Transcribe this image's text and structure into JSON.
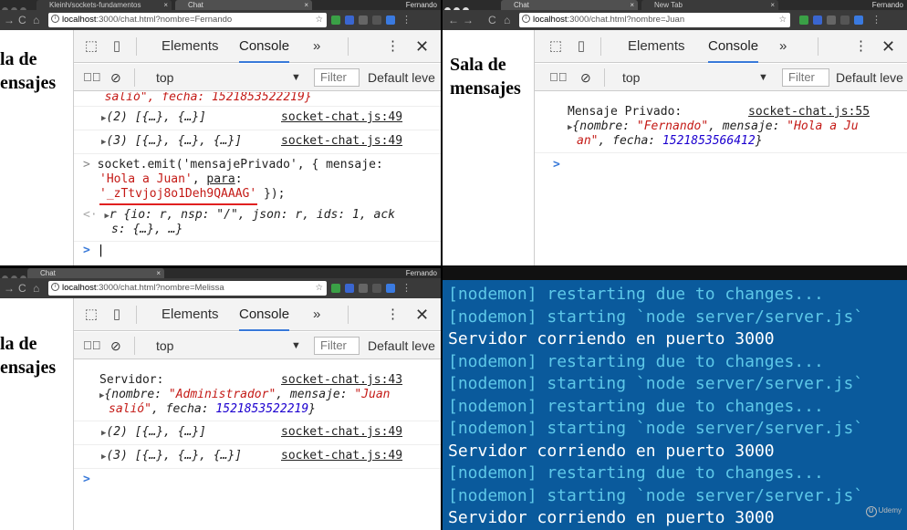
{
  "windows": [
    {
      "tabs": [
        {
          "label": "Kleinh/sockets-fundamentos"
        },
        {
          "label": "Chat"
        }
      ],
      "profile": "Fernando",
      "url_host": "localhost",
      "url_path": ":3000/chat.html?nombre=Fernando",
      "page_title_line1": "la de",
      "page_title_line2": "ensajes",
      "devtools": {
        "elements_tab": "Elements",
        "console_tab": "Console",
        "more": "»",
        "context": "top",
        "filter": "Filter",
        "levels": "Default leve"
      },
      "console": {
        "partial_line": "  salió\", fecha: 1521853522219}",
        "arr2": "(2) [{…}, {…}]",
        "arr2_src": "socket-chat.js:49",
        "arr3": "(3) [{…}, {…}, {…}]",
        "arr3_src": "socket-chat.js:49",
        "cmd_line1": "socket.emit('mensajePrivado', { mensaje:",
        "cmd_line2a": "'Hola a Juan'",
        "cmd_line2b": ", ",
        "cmd_line2c": "para",
        "cmd_line2d": ":",
        "cmd_line3a": "'_zTtvjoj8o1Deh9QAAAG'",
        "cmd_line3b": " });",
        "result_line1": "r {io: r, nsp: \"/\", json: r, ids: 1, ack",
        "result_line2": "s: {…}, …}"
      }
    },
    {
      "tabs": [
        {
          "label": "Chat"
        },
        {
          "label": "New Tab"
        }
      ],
      "profile": "Fernando",
      "url_host": "localhost",
      "url_path": ":3000/chat.html?nombre=Juan",
      "page_title_line1": "Sala de",
      "page_title_line2": "mensajes",
      "devtools": {
        "elements_tab": "Elements",
        "console_tab": "Console",
        "more": "»",
        "context": "top",
        "filter": "Filter",
        "levels": "Default leve"
      },
      "console": {
        "msg_label": "Mensaje Privado:",
        "msg_src": "socket-chat.js:55",
        "msg_obj1a": "{nombre: ",
        "msg_obj1b": "\"Fernando\"",
        "msg_obj1c": ", mensaje: ",
        "msg_obj1d": "\"Hola a Ju",
        "msg_obj2a": "an\"",
        "msg_obj2b": ", fecha: ",
        "msg_obj2c": "1521853566412",
        "msg_obj2d": "}"
      }
    },
    {
      "tabs": [
        {
          "label": "Chat"
        }
      ],
      "profile": "Fernando",
      "url_host": "localhost",
      "url_path": ":3000/chat.html?nombre=Melissa",
      "page_title_line1": "la de",
      "page_title_line2": "ensajes",
      "devtools": {
        "elements_tab": "Elements",
        "console_tab": "Console",
        "more": "»",
        "context": "top",
        "filter": "Filter",
        "levels": "Default leve"
      },
      "console": {
        "srv_label": "Servidor:",
        "srv_src": "socket-chat.js:43",
        "obj1a": "{nombre: ",
        "obj1b": "\"Administrador\"",
        "obj1c": ", mensaje: ",
        "obj1d": "\"Juan",
        "obj2a": "salió\"",
        "obj2b": ", fecha: ",
        "obj2c": "1521853522219",
        "obj2d": "}",
        "arr2": "(2) [{…}, {…}]",
        "arr2_src": "socket-chat.js:49",
        "arr3": "(3) [{…}, {…}, {…}]",
        "arr3_src": "socket-chat.js:49"
      }
    }
  ],
  "terminal": {
    "lines": [
      {
        "text": "[nodemon] restarting due to changes...",
        "kind": "nodemon"
      },
      {
        "text": "[nodemon] starting `node server/server.js`",
        "kind": "nodemon"
      },
      {
        "text": "Servidor corriendo en puerto 3000",
        "kind": "server"
      },
      {
        "text": "[nodemon] restarting due to changes...",
        "kind": "nodemon"
      },
      {
        "text": "[nodemon] starting `node server/server.js`",
        "kind": "nodemon"
      },
      {
        "text": "[nodemon] restarting due to changes...",
        "kind": "nodemon"
      },
      {
        "text": "[nodemon] starting `node server/server.js`",
        "kind": "nodemon"
      },
      {
        "text": "Servidor corriendo en puerto 3000",
        "kind": "server"
      },
      {
        "text": "[nodemon] restarting due to changes...",
        "kind": "nodemon"
      },
      {
        "text": "[nodemon] starting `node server/server.js`",
        "kind": "nodemon"
      },
      {
        "text": "Servidor corriendo en puerto 3000",
        "kind": "server"
      }
    ],
    "watermark": "Udemy"
  },
  "colors": {
    "terminal_bg": "#0a5a9c",
    "nodemon_text": "#5ec8e8",
    "server_text": "#ffffff",
    "console_string": "#c41a16",
    "console_number": "#1c00cf",
    "underline_annotation": "#e02020"
  }
}
